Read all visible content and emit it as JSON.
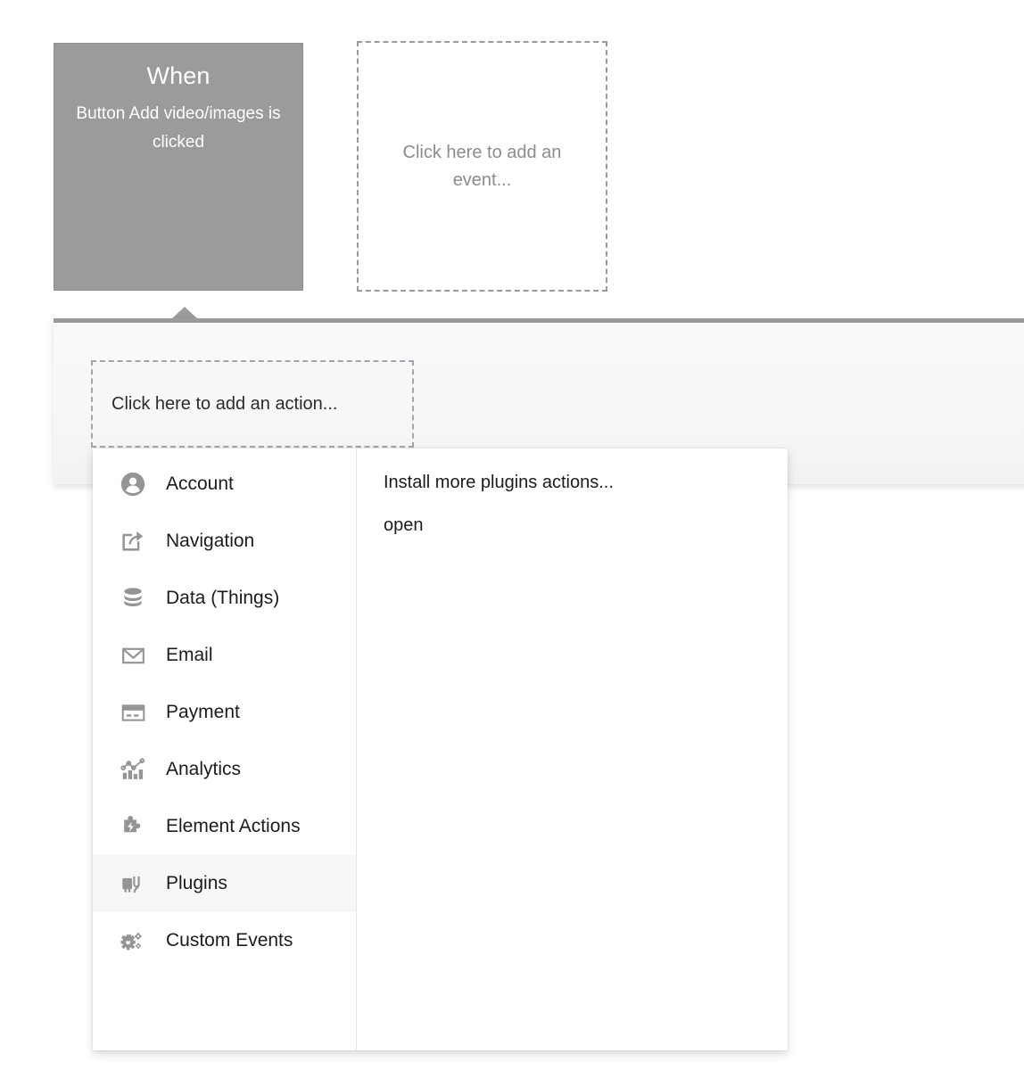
{
  "workflow": {
    "when_card": {
      "title": "When",
      "subtitle": "Button Add video/images is clicked",
      "bg_color": "#9b9b9b"
    },
    "add_event_placeholder": "Click here to add an event...",
    "add_action_placeholder": "Click here to add an action..."
  },
  "action_menu": {
    "categories": [
      {
        "label": "Account",
        "icon": "account-icon",
        "selected": false
      },
      {
        "label": "Navigation",
        "icon": "navigation-icon",
        "selected": false
      },
      {
        "label": "Data (Things)",
        "icon": "database-icon",
        "selected": false
      },
      {
        "label": "Email",
        "icon": "envelope-icon",
        "selected": false
      },
      {
        "label": "Payment",
        "icon": "credit-card-icon",
        "selected": false
      },
      {
        "label": "Analytics",
        "icon": "analytics-chart-icon",
        "selected": false
      },
      {
        "label": "Element Actions",
        "icon": "puzzle-bolt-icon",
        "selected": false
      },
      {
        "label": "Plugins",
        "icon": "plug-icon",
        "selected": true
      },
      {
        "label": "Custom Events",
        "icon": "gears-icon",
        "selected": false
      }
    ],
    "detail_items": [
      {
        "label": "Install more plugins actions..."
      },
      {
        "label": "open"
      }
    ],
    "selected_category": "Plugins",
    "highlight_color": "#f7f7f7",
    "icon_color": "#949494"
  }
}
